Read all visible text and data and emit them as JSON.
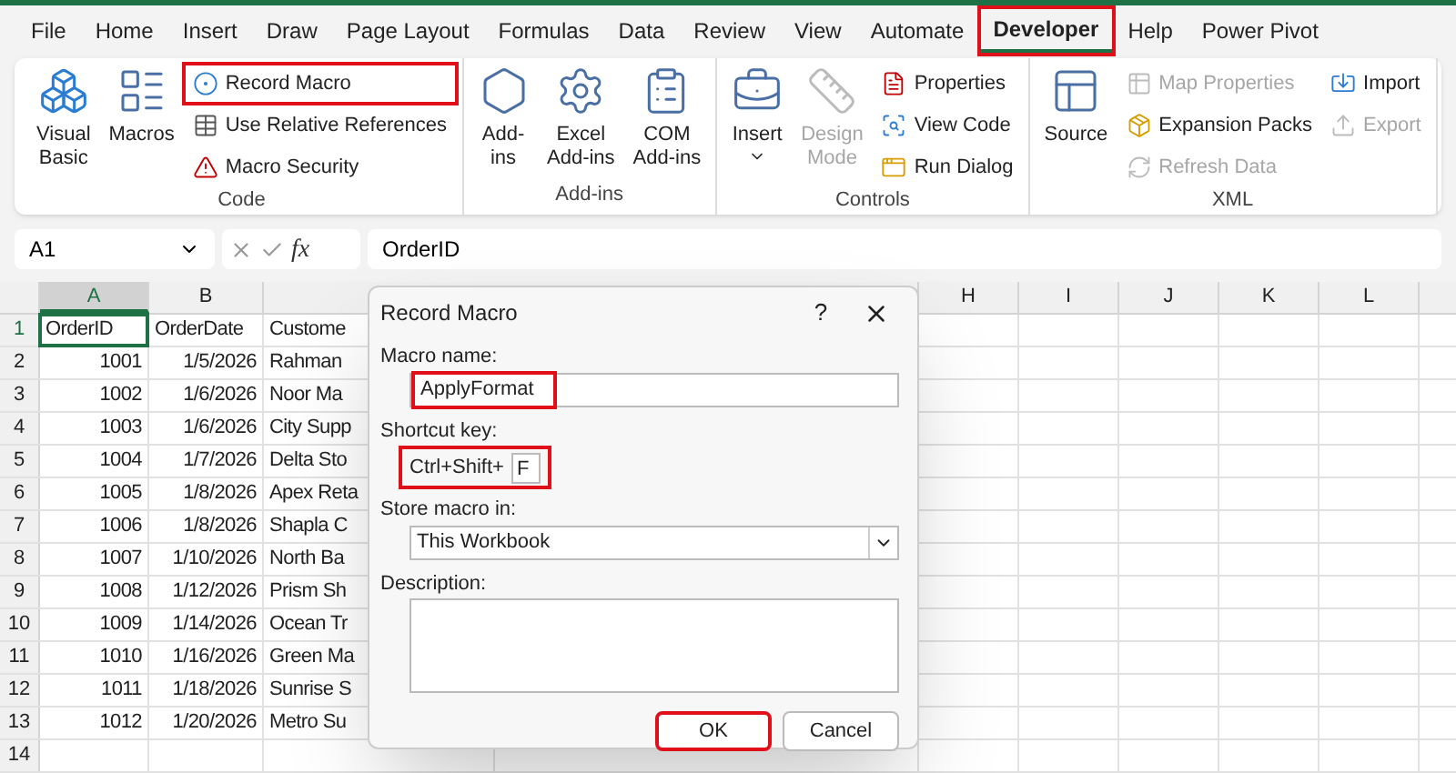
{
  "menu_tabs": [
    {
      "label": "File",
      "selected": false,
      "highlighted": false
    },
    {
      "label": "Home",
      "selected": false,
      "highlighted": false
    },
    {
      "label": "Insert",
      "selected": false,
      "highlighted": false
    },
    {
      "label": "Draw",
      "selected": false,
      "highlighted": false
    },
    {
      "label": "Page Layout",
      "selected": false,
      "highlighted": false
    },
    {
      "label": "Formulas",
      "selected": false,
      "highlighted": false
    },
    {
      "label": "Data",
      "selected": false,
      "highlighted": false
    },
    {
      "label": "Review",
      "selected": false,
      "highlighted": false
    },
    {
      "label": "View",
      "selected": false,
      "highlighted": false
    },
    {
      "label": "Automate",
      "selected": false,
      "highlighted": false
    },
    {
      "label": "Developer",
      "selected": true,
      "highlighted": true
    },
    {
      "label": "Help",
      "selected": false,
      "highlighted": false
    },
    {
      "label": "Power Pivot",
      "selected": false,
      "highlighted": false
    }
  ],
  "ribbon": {
    "groups": [
      {
        "label": "Code",
        "items": [
          {
            "kind": "large",
            "lines": [
              "Visual",
              "Basic"
            ],
            "disabled": false
          },
          {
            "kind": "large",
            "lines": [
              "Macros"
            ],
            "disabled": false
          },
          {
            "kind": "stack",
            "items": [
              {
                "label": "Record Macro",
                "disabled": false,
                "highlighted": true
              },
              {
                "label": "Use Relative References",
                "disabled": false,
                "highlighted": false
              },
              {
                "label": "Macro Security",
                "disabled": false,
                "highlighted": false
              }
            ]
          }
        ]
      },
      {
        "label": "Add-ins",
        "items": [
          {
            "kind": "large",
            "lines": [
              "Add-",
              "ins"
            ],
            "disabled": false
          },
          {
            "kind": "large",
            "lines": [
              "Excel",
              "Add-ins"
            ],
            "disabled": false
          },
          {
            "kind": "large",
            "lines": [
              "COM",
              "Add-ins"
            ],
            "disabled": false
          }
        ]
      },
      {
        "label": "Controls",
        "items": [
          {
            "kind": "large",
            "lines": [
              "Insert"
            ],
            "disabled": false,
            "dropdown": true
          },
          {
            "kind": "large",
            "lines": [
              "Design",
              "Mode"
            ],
            "disabled": true
          },
          {
            "kind": "stack",
            "items": [
              {
                "label": "Properties",
                "disabled": false,
                "highlighted": false
              },
              {
                "label": "View Code",
                "disabled": false,
                "highlighted": false
              },
              {
                "label": "Run Dialog",
                "disabled": false,
                "highlighted": false
              }
            ]
          }
        ]
      },
      {
        "label": "XML",
        "items": [
          {
            "kind": "large",
            "lines": [
              "Source"
            ],
            "disabled": false
          },
          {
            "kind": "stack",
            "items": [
              {
                "label": "Map Properties",
                "disabled": true,
                "highlighted": false
              },
              {
                "label": "Expansion Packs",
                "disabled": false,
                "highlighted": false
              },
              {
                "label": "Refresh Data",
                "disabled": true,
                "highlighted": false
              }
            ]
          },
          {
            "kind": "stack",
            "items": [
              {
                "label": "Import",
                "disabled": false,
                "highlighted": false
              },
              {
                "label": "Export",
                "disabled": true,
                "highlighted": false
              }
            ]
          }
        ]
      }
    ]
  },
  "formula_bar": {
    "name_box": "A1",
    "function_symbol": "fx",
    "value": "OrderID"
  },
  "sheet": {
    "left_columns": [
      {
        "label": "A",
        "selected": true
      },
      {
        "label": "B",
        "selected": false
      }
    ],
    "right_columns": [
      "H",
      "I",
      "J",
      "K",
      "L"
    ],
    "rows": [
      {
        "number": "1",
        "cells": [
          {
            "text": "OrderID",
            "kind": "text",
            "selected": true
          },
          {
            "text": "OrderDate",
            "kind": "text",
            "selected": false
          },
          {
            "text": "Custome",
            "kind": "text",
            "selected": false
          }
        ]
      },
      {
        "number": "2",
        "cells": [
          {
            "text": "1001",
            "kind": "number",
            "selected": false
          },
          {
            "text": "1/5/2026",
            "kind": "number",
            "selected": false
          },
          {
            "text": "Rahman",
            "kind": "text",
            "selected": false
          }
        ]
      },
      {
        "number": "3",
        "cells": [
          {
            "text": "1002",
            "kind": "number",
            "selected": false
          },
          {
            "text": "1/6/2026",
            "kind": "number",
            "selected": false
          },
          {
            "text": "Noor Ma",
            "kind": "text",
            "selected": false
          }
        ]
      },
      {
        "number": "4",
        "cells": [
          {
            "text": "1003",
            "kind": "number",
            "selected": false
          },
          {
            "text": "1/6/2026",
            "kind": "number",
            "selected": false
          },
          {
            "text": "City Supp",
            "kind": "text",
            "selected": false
          }
        ]
      },
      {
        "number": "5",
        "cells": [
          {
            "text": "1004",
            "kind": "number",
            "selected": false
          },
          {
            "text": "1/7/2026",
            "kind": "number",
            "selected": false
          },
          {
            "text": "Delta Sto",
            "kind": "text",
            "selected": false
          }
        ]
      },
      {
        "number": "6",
        "cells": [
          {
            "text": "1005",
            "kind": "number",
            "selected": false
          },
          {
            "text": "1/8/2026",
            "kind": "number",
            "selected": false
          },
          {
            "text": "Apex Reta",
            "kind": "text",
            "selected": false
          }
        ]
      },
      {
        "number": "7",
        "cells": [
          {
            "text": "1006",
            "kind": "number",
            "selected": false
          },
          {
            "text": "1/8/2026",
            "kind": "number",
            "selected": false
          },
          {
            "text": "Shapla C",
            "kind": "text",
            "selected": false
          }
        ]
      },
      {
        "number": "8",
        "cells": [
          {
            "text": "1007",
            "kind": "number",
            "selected": false
          },
          {
            "text": "1/10/2026",
            "kind": "number",
            "selected": false
          },
          {
            "text": "North Ba",
            "kind": "text",
            "selected": false
          }
        ]
      },
      {
        "number": "9",
        "cells": [
          {
            "text": "1008",
            "kind": "number",
            "selected": false
          },
          {
            "text": "1/12/2026",
            "kind": "number",
            "selected": false
          },
          {
            "text": "Prism Sh",
            "kind": "text",
            "selected": false
          }
        ]
      },
      {
        "number": "10",
        "cells": [
          {
            "text": "1009",
            "kind": "number",
            "selected": false
          },
          {
            "text": "1/14/2026",
            "kind": "number",
            "selected": false
          },
          {
            "text": "Ocean Tr",
            "kind": "text",
            "selected": false
          }
        ]
      },
      {
        "number": "11",
        "cells": [
          {
            "text": "1010",
            "kind": "number",
            "selected": false
          },
          {
            "text": "1/16/2026",
            "kind": "number",
            "selected": false
          },
          {
            "text": "Green Ma",
            "kind": "text",
            "selected": false
          }
        ]
      },
      {
        "number": "12",
        "cells": [
          {
            "text": "1011",
            "kind": "number",
            "selected": false
          },
          {
            "text": "1/18/2026",
            "kind": "number",
            "selected": false
          },
          {
            "text": "Sunrise S",
            "kind": "text",
            "selected": false
          }
        ]
      },
      {
        "number": "13",
        "cells": [
          {
            "text": "1012",
            "kind": "number",
            "selected": false
          },
          {
            "text": "1/20/2026",
            "kind": "number",
            "selected": false
          },
          {
            "text": "Metro Su",
            "kind": "text",
            "selected": false
          }
        ]
      },
      {
        "number": "14"
      }
    ]
  },
  "dialog": {
    "title": "Record Macro",
    "help": "?",
    "macro_name": {
      "label": "Macro name:",
      "value": "ApplyFormat",
      "highlighted": true
    },
    "shortcut": {
      "label": "Shortcut key:",
      "prefix": "Ctrl+Shift+",
      "value": "F",
      "highlighted": true
    },
    "store_in": {
      "label": "Store macro in:",
      "value": "This Workbook"
    },
    "description": {
      "label": "Description:"
    },
    "buttons": [
      {
        "label": "OK",
        "highlighted": true
      },
      {
        "label": "Cancel",
        "highlighted": false
      }
    ]
  }
}
